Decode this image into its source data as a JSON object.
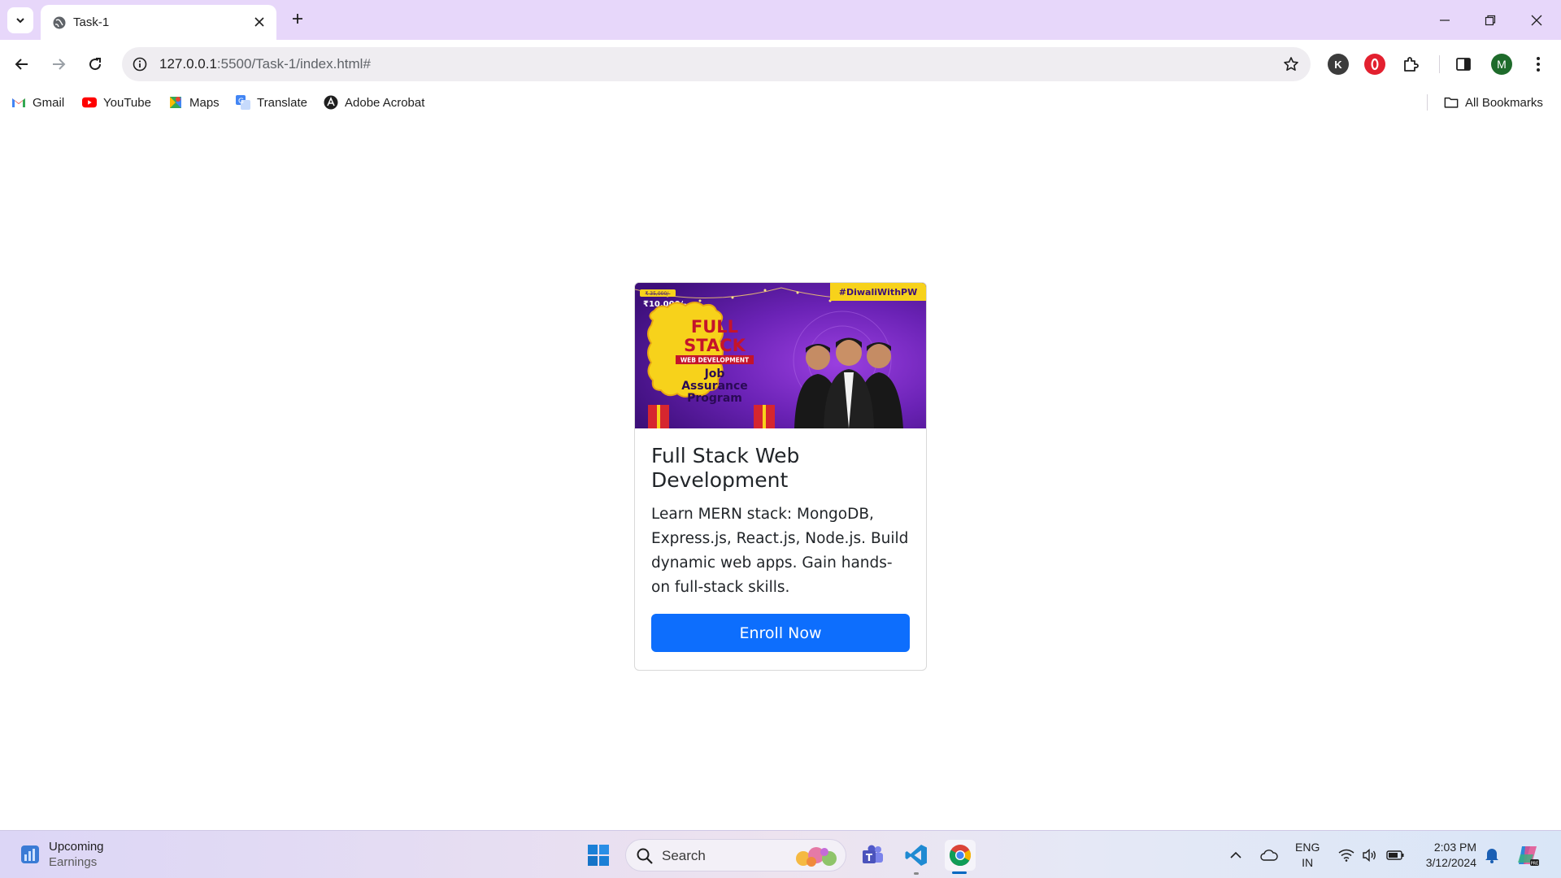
{
  "browser": {
    "tab": {
      "title": "Task-1"
    },
    "address_bar": {
      "host": "127.0.0.1",
      "rest": ":5500/Task-1/index.html#"
    },
    "profile_initial": "M",
    "extension_k_letter": "K",
    "bookmarks": [
      {
        "label": "Gmail",
        "icon": "gmail-icon"
      },
      {
        "label": "YouTube",
        "icon": "youtube-icon"
      },
      {
        "label": "Maps",
        "icon": "maps-icon"
      },
      {
        "label": "Translate",
        "icon": "translate-icon"
      },
      {
        "label": "Adobe Acrobat",
        "icon": "acrobat-icon"
      }
    ],
    "all_bookmarks_label": "All Bookmarks"
  },
  "card": {
    "banner": {
      "hashtag": "#DiwaliWithPW",
      "old_price": "₹ 35,000/-",
      "price": "₹10,000/-",
      "line1": "FULL",
      "line2": "STACK",
      "ribbon": "WEB DEVELOPMENT",
      "line3": "Job",
      "line4": "Assurance",
      "line5": "Program"
    },
    "title": "Full Stack Web Development",
    "text": "Learn MERN stack: MongoDB, Express.js, React.js, Node.js. Build dynamic web apps. Gain hands-on full-stack skills.",
    "button_label": "Enroll Now"
  },
  "taskbar": {
    "widget": {
      "title": "Upcoming",
      "subtitle": "Earnings"
    },
    "search_label": "Search",
    "language": {
      "line1": "ENG",
      "line2": "IN"
    },
    "clock": {
      "time": "2:03 PM",
      "date": "3/12/2024"
    }
  },
  "colors": {
    "tabstrip": "#e7d7fa",
    "primary_button": "#0d6efd",
    "banner_purple": "#5c1ba3",
    "banner_yellow": "#f7d21b"
  }
}
